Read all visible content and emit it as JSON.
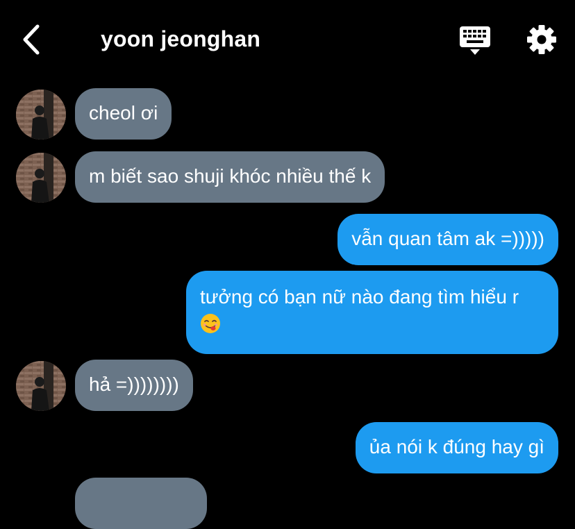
{
  "header": {
    "title": "yoon jeonghan",
    "back_icon": "chevron-left-icon",
    "keyboard_icon": "keyboard-icon",
    "settings_icon": "gear-icon"
  },
  "colors": {
    "background": "#000000",
    "incoming_bubble": "#677786",
    "outgoing_bubble": "#1d9bf0",
    "text": "#ffffff"
  },
  "messages": [
    {
      "direction": "incoming",
      "text": "cheol ơi",
      "has_avatar": true
    },
    {
      "direction": "incoming",
      "text": "m biết sao shuji khóc nhiều thế k",
      "has_avatar": true
    },
    {
      "direction": "outgoing",
      "text": "vẫn quan tâm ak =)))))"
    },
    {
      "direction": "outgoing",
      "text": "tưởng có bạn nữ nào đang tìm hiểu r",
      "emoji": "face-savoring-food-emoji"
    },
    {
      "direction": "incoming",
      "text": "hả =))))))))",
      "has_avatar": true
    },
    {
      "direction": "outgoing",
      "text": "ủa nói k đúng hay gì"
    }
  ]
}
